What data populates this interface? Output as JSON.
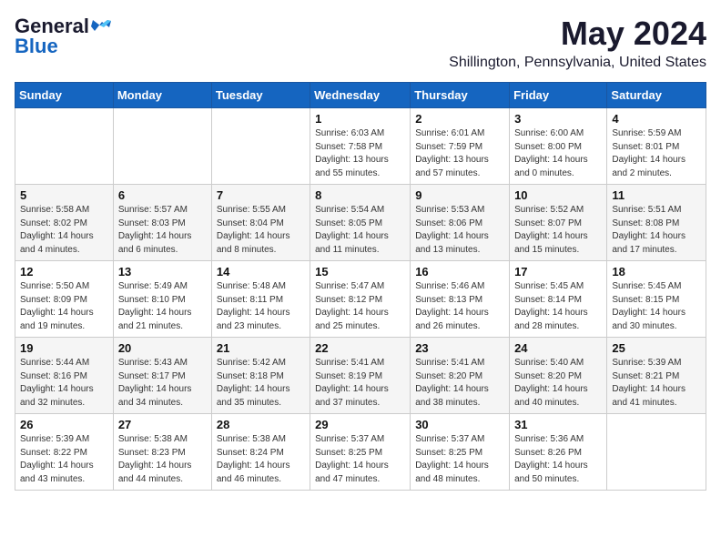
{
  "logo": {
    "line1": "General",
    "line2": "Blue",
    "icon": "▶"
  },
  "header": {
    "month": "May 2024",
    "location": "Shillington, Pennsylvania, United States"
  },
  "weekdays": [
    "Sunday",
    "Monday",
    "Tuesday",
    "Wednesday",
    "Thursday",
    "Friday",
    "Saturday"
  ],
  "weeks": [
    [
      {
        "day": "",
        "info": ""
      },
      {
        "day": "",
        "info": ""
      },
      {
        "day": "",
        "info": ""
      },
      {
        "day": "1",
        "info": "Sunrise: 6:03 AM\nSunset: 7:58 PM\nDaylight: 13 hours\nand 55 minutes."
      },
      {
        "day": "2",
        "info": "Sunrise: 6:01 AM\nSunset: 7:59 PM\nDaylight: 13 hours\nand 57 minutes."
      },
      {
        "day": "3",
        "info": "Sunrise: 6:00 AM\nSunset: 8:00 PM\nDaylight: 14 hours\nand 0 minutes."
      },
      {
        "day": "4",
        "info": "Sunrise: 5:59 AM\nSunset: 8:01 PM\nDaylight: 14 hours\nand 2 minutes."
      }
    ],
    [
      {
        "day": "5",
        "info": "Sunrise: 5:58 AM\nSunset: 8:02 PM\nDaylight: 14 hours\nand 4 minutes."
      },
      {
        "day": "6",
        "info": "Sunrise: 5:57 AM\nSunset: 8:03 PM\nDaylight: 14 hours\nand 6 minutes."
      },
      {
        "day": "7",
        "info": "Sunrise: 5:55 AM\nSunset: 8:04 PM\nDaylight: 14 hours\nand 8 minutes."
      },
      {
        "day": "8",
        "info": "Sunrise: 5:54 AM\nSunset: 8:05 PM\nDaylight: 14 hours\nand 11 minutes."
      },
      {
        "day": "9",
        "info": "Sunrise: 5:53 AM\nSunset: 8:06 PM\nDaylight: 14 hours\nand 13 minutes."
      },
      {
        "day": "10",
        "info": "Sunrise: 5:52 AM\nSunset: 8:07 PM\nDaylight: 14 hours\nand 15 minutes."
      },
      {
        "day": "11",
        "info": "Sunrise: 5:51 AM\nSunset: 8:08 PM\nDaylight: 14 hours\nand 17 minutes."
      }
    ],
    [
      {
        "day": "12",
        "info": "Sunrise: 5:50 AM\nSunset: 8:09 PM\nDaylight: 14 hours\nand 19 minutes."
      },
      {
        "day": "13",
        "info": "Sunrise: 5:49 AM\nSunset: 8:10 PM\nDaylight: 14 hours\nand 21 minutes."
      },
      {
        "day": "14",
        "info": "Sunrise: 5:48 AM\nSunset: 8:11 PM\nDaylight: 14 hours\nand 23 minutes."
      },
      {
        "day": "15",
        "info": "Sunrise: 5:47 AM\nSunset: 8:12 PM\nDaylight: 14 hours\nand 25 minutes."
      },
      {
        "day": "16",
        "info": "Sunrise: 5:46 AM\nSunset: 8:13 PM\nDaylight: 14 hours\nand 26 minutes."
      },
      {
        "day": "17",
        "info": "Sunrise: 5:45 AM\nSunset: 8:14 PM\nDaylight: 14 hours\nand 28 minutes."
      },
      {
        "day": "18",
        "info": "Sunrise: 5:45 AM\nSunset: 8:15 PM\nDaylight: 14 hours\nand 30 minutes."
      }
    ],
    [
      {
        "day": "19",
        "info": "Sunrise: 5:44 AM\nSunset: 8:16 PM\nDaylight: 14 hours\nand 32 minutes."
      },
      {
        "day": "20",
        "info": "Sunrise: 5:43 AM\nSunset: 8:17 PM\nDaylight: 14 hours\nand 34 minutes."
      },
      {
        "day": "21",
        "info": "Sunrise: 5:42 AM\nSunset: 8:18 PM\nDaylight: 14 hours\nand 35 minutes."
      },
      {
        "day": "22",
        "info": "Sunrise: 5:41 AM\nSunset: 8:19 PM\nDaylight: 14 hours\nand 37 minutes."
      },
      {
        "day": "23",
        "info": "Sunrise: 5:41 AM\nSunset: 8:20 PM\nDaylight: 14 hours\nand 38 minutes."
      },
      {
        "day": "24",
        "info": "Sunrise: 5:40 AM\nSunset: 8:20 PM\nDaylight: 14 hours\nand 40 minutes."
      },
      {
        "day": "25",
        "info": "Sunrise: 5:39 AM\nSunset: 8:21 PM\nDaylight: 14 hours\nand 41 minutes."
      }
    ],
    [
      {
        "day": "26",
        "info": "Sunrise: 5:39 AM\nSunset: 8:22 PM\nDaylight: 14 hours\nand 43 minutes."
      },
      {
        "day": "27",
        "info": "Sunrise: 5:38 AM\nSunset: 8:23 PM\nDaylight: 14 hours\nand 44 minutes."
      },
      {
        "day": "28",
        "info": "Sunrise: 5:38 AM\nSunset: 8:24 PM\nDaylight: 14 hours\nand 46 minutes."
      },
      {
        "day": "29",
        "info": "Sunrise: 5:37 AM\nSunset: 8:25 PM\nDaylight: 14 hours\nand 47 minutes."
      },
      {
        "day": "30",
        "info": "Sunrise: 5:37 AM\nSunset: 8:25 PM\nDaylight: 14 hours\nand 48 minutes."
      },
      {
        "day": "31",
        "info": "Sunrise: 5:36 AM\nSunset: 8:26 PM\nDaylight: 14 hours\nand 50 minutes."
      },
      {
        "day": "",
        "info": ""
      }
    ]
  ]
}
